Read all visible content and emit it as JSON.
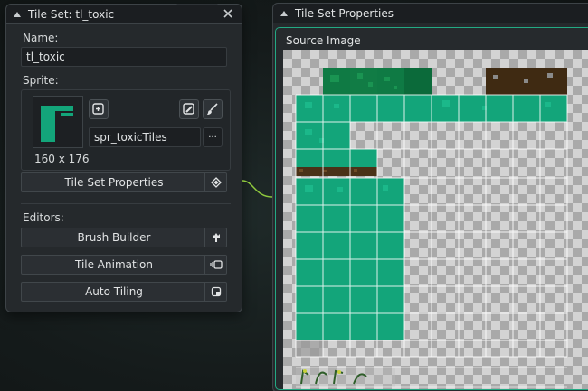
{
  "tileset_panel": {
    "title": "Tile Set: tl_toxic",
    "name_label": "Name:",
    "name_value": "tl_toxic",
    "sprite_label": "Sprite:",
    "sprite_name": "spr_toxicTiles",
    "sprite_size": "160 x 176",
    "more_label": "···",
    "properties_button": "Tile Set Properties",
    "editors_label": "Editors:",
    "brush_builder": "Brush Builder",
    "tile_animation": "Tile Animation",
    "auto_tiling": "Auto Tiling"
  },
  "properties_panel": {
    "title": "Tile Set Properties",
    "source_image_label": "Source Image"
  },
  "colors": {
    "accent_green": "#13a57a",
    "dark_green": "#0f7a44",
    "dirt": "#4a3218",
    "panel_bg": "#25292c"
  }
}
